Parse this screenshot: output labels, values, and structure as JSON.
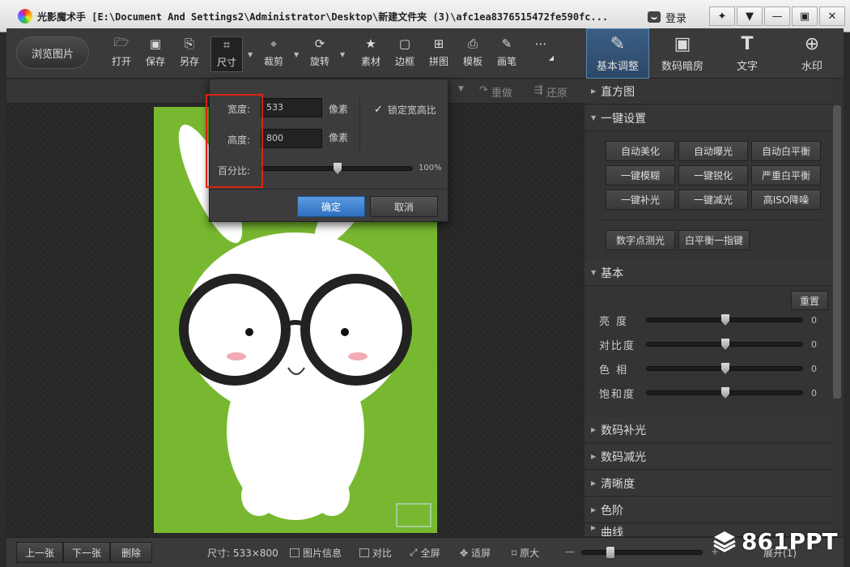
{
  "app": {
    "title": "光影魔术手  [E:\\Document And Settings2\\Administrator\\Desktop\\新建文件夹 (3)\\afc1ea8376515472fe590fc...",
    "login": "登录"
  },
  "toolbar": {
    "browse": "浏览图片",
    "tools": [
      {
        "label": "打开",
        "icon": "open-icon"
      },
      {
        "label": "保存",
        "icon": "save-icon"
      },
      {
        "label": "另存",
        "icon": "save-as-icon"
      },
      {
        "label": "尺寸",
        "icon": "resize-icon"
      },
      {
        "label": "裁剪",
        "icon": "crop-icon"
      },
      {
        "label": "旋转",
        "icon": "rotate-icon"
      },
      {
        "label": "素材",
        "icon": "material-icon"
      },
      {
        "label": "边框",
        "icon": "border-icon"
      },
      {
        "label": "拼图",
        "icon": "collage-icon"
      },
      {
        "label": "模板",
        "icon": "template-icon"
      },
      {
        "label": "画笔",
        "icon": "brush-icon"
      }
    ],
    "right_tabs": [
      {
        "label": "基本调整",
        "icon": "adjust-icon"
      },
      {
        "label": "数码暗房",
        "icon": "darkroom-icon"
      },
      {
        "label": "文字",
        "icon": "text-icon"
      },
      {
        "label": "水印",
        "icon": "watermark-icon"
      }
    ]
  },
  "subbar": {
    "redo": "重做",
    "restore": "还原"
  },
  "size_dialog": {
    "width_label": "宽度:",
    "width_value": "533",
    "height_label": "高度:",
    "height_value": "800",
    "unit": "像素",
    "lock_label": "锁定宽高比",
    "lock_checked": true,
    "percent_label": "百分比:",
    "percent_value": "100%",
    "percent": 100,
    "ok": "确定",
    "cancel": "取消"
  },
  "right_panel": {
    "histogram": "直方图",
    "one_click": "一键设置",
    "quick_buttons": [
      "自动美化",
      "自动曝光",
      "自动白平衡",
      "一键模糊",
      "一键锐化",
      "严重白平衡",
      "一键补光",
      "一键减光",
      "高ISO降噪"
    ],
    "extra_buttons": [
      "数字点测光",
      "白平衡一指键"
    ],
    "basic": "基本",
    "reset": "重置",
    "sliders": [
      {
        "label": "亮  度",
        "value": "0"
      },
      {
        "label": "对比度",
        "value": "0"
      },
      {
        "label": "色  相",
        "value": "0"
      },
      {
        "label": "饱和度",
        "value": "0"
      }
    ],
    "collapsed": [
      "数码补光",
      "数码减光",
      "清晰度",
      "色阶",
      "曲线"
    ]
  },
  "bottom": {
    "prev": "上一张",
    "next": "下一张",
    "delete": "删除",
    "size_info": "尺寸: 533×800",
    "photo_info": "图片信息",
    "compare": "对比",
    "fullscreen": "全屏",
    "fit": "适屏",
    "original": "原大",
    "expand": "展开(1)"
  },
  "watermark": "861PPT"
}
